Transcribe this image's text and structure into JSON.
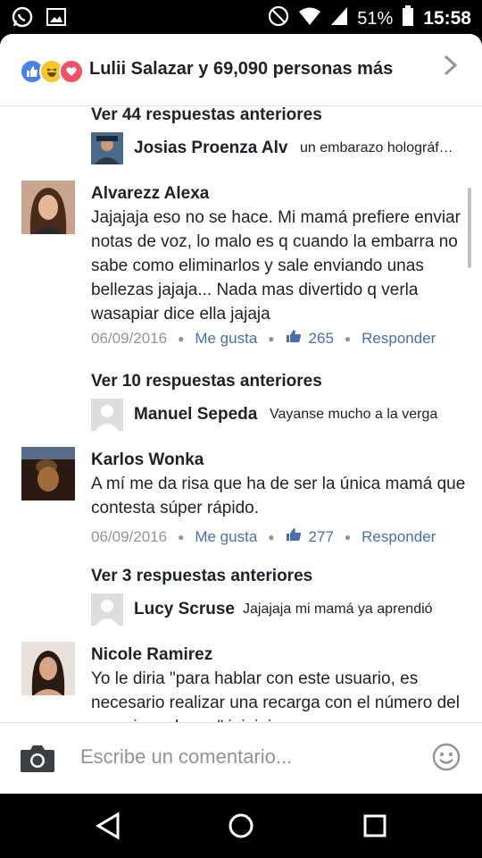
{
  "status_bar": {
    "battery_percent": "51%",
    "time": "15:58",
    "icons": [
      "whatsapp-icon",
      "image-icon",
      "do-not-disturb-icon",
      "wifi-icon",
      "signal-icon",
      "battery-icon"
    ]
  },
  "reactions": {
    "icons": [
      "like-icon",
      "haha-icon",
      "love-icon"
    ],
    "label": "Lulii Salazar y 69,090 personas más"
  },
  "threads": [
    {
      "more_label": "Ver 44 respuestas anteriores",
      "reply": {
        "name": "Josias Proenza Alv",
        "text": "un embarazo holográfico"
      },
      "comment": {
        "name": "Alvarezz Alexa",
        "text": "Jajajaja eso no se hace. Mi mamá prefiere enviar notas de voz, lo malo es q cuando la embarra no sabe como eliminarlos y sale enviando unas bellezas jajaja... Nada mas divertido q verla wasapiar dice ella jajaja",
        "date": "06/09/2016",
        "like_label": "Me gusta",
        "like_count": "265",
        "reply_label": "Responder"
      }
    },
    {
      "more_label": "Ver 10 respuestas anteriores",
      "reply": {
        "name": "Manuel Sepeda",
        "text": "Vayanse mucho a la verga"
      },
      "comment": {
        "name": "Karlos Wonka",
        "text": "A mí me da risa que ha de ser la única mamá que contesta súper rápido.",
        "date": "06/09/2016",
        "like_label": "Me gusta",
        "like_count": "277",
        "reply_label": "Responder"
      }
    },
    {
      "more_label": "Ver 3 respuestas anteriores",
      "reply": {
        "name": "Lucy Scruse",
        "text": "Jajajaja mi mamá ya aprendió"
      },
      "comment": {
        "name": "Nicole Ramirez",
        "text": "Yo le diria \"para hablar con este usuario, es necesario realizar una recarga con el número del usuario en breve\" jejejeje"
      }
    }
  ],
  "input": {
    "placeholder": "Escribe un comentario..."
  },
  "colors": {
    "link": "#4a6ea9",
    "meta": "#90949c",
    "like_blue": "#4a7fe5"
  }
}
